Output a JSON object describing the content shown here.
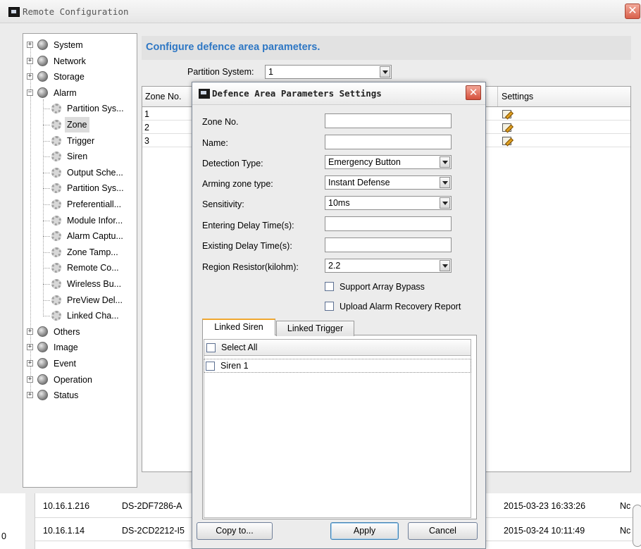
{
  "main_window": {
    "title": "Remote Configuration",
    "close_glyph": "✕"
  },
  "tree": {
    "items": [
      {
        "label": "System",
        "expander": "+",
        "level": 0
      },
      {
        "label": "Network",
        "expander": "+",
        "level": 0
      },
      {
        "label": "Storage",
        "expander": "+",
        "level": 0
      },
      {
        "label": "Alarm",
        "expander": "−",
        "level": 0
      },
      {
        "label": "Partition Sys...",
        "level": 1
      },
      {
        "label": "Zone",
        "level": 1,
        "selected": true
      },
      {
        "label": "Trigger",
        "level": 1
      },
      {
        "label": "Siren",
        "level": 1
      },
      {
        "label": "Output Sche...",
        "level": 1
      },
      {
        "label": "Partition Sys...",
        "level": 1
      },
      {
        "label": "Preferentiall...",
        "level": 1
      },
      {
        "label": "Module Infor...",
        "level": 1
      },
      {
        "label": "Alarm Captu...",
        "level": 1
      },
      {
        "label": "Zone Tamp...",
        "level": 1
      },
      {
        "label": "Remote Co...",
        "level": 1
      },
      {
        "label": "Wireless Bu...",
        "level": 1
      },
      {
        "label": "PreView Del...",
        "level": 1
      },
      {
        "label": "Linked Cha...",
        "level": 1
      },
      {
        "label": "Others",
        "expander": "+",
        "level": 0
      },
      {
        "label": "Image",
        "expander": "+",
        "level": 0
      },
      {
        "label": "Event",
        "expander": "+",
        "level": 0
      },
      {
        "label": "Operation",
        "expander": "+",
        "level": 0
      },
      {
        "label": "Status",
        "expander": "+",
        "level": 0
      }
    ]
  },
  "config": {
    "heading": "Configure defence area parameters.",
    "partition_label": "Partition System:",
    "partition_value": "1",
    "table": {
      "col_zone": "Zone No.",
      "col_settings": "Settings",
      "rows": [
        {
          "zone": "1"
        },
        {
          "zone": "2"
        },
        {
          "zone": "3"
        }
      ]
    }
  },
  "devices": {
    "rows": [
      {
        "ip": "10.16.1.216",
        "model": "DS-2DF7286-A",
        "time": "2015-03-23 16:33:26",
        "status": "Nc"
      },
      {
        "ip": "10.16.1.14",
        "model": "DS-2CD2212-I5",
        "time": "2015-03-24 10:11:49",
        "status": "Nc"
      }
    ],
    "left_fragment": "0"
  },
  "dialog": {
    "title": "Defence Area Parameters Settings",
    "close_glyph": "✕",
    "fields": {
      "zone_no_label": "Zone No.",
      "zone_no_value": "",
      "name_label": "Name:",
      "name_value": "",
      "detection_type_label": "Detection Type:",
      "detection_type_value": "Emergency Button",
      "arming_zone_type_label": "Arming zone type:",
      "arming_zone_type_value": "Instant Defense",
      "sensitivity_label": "Sensitivity:",
      "sensitivity_value": "10ms",
      "entering_delay_label": "Entering Delay Time(s):",
      "entering_delay_value": "",
      "existing_delay_label": "Existing Delay Time(s):",
      "existing_delay_value": "",
      "region_resistor_label": "Region Resistor(kilohm):",
      "region_resistor_value": "2.2"
    },
    "checkboxes": {
      "support_array_bypass": "Support Array Bypass",
      "upload_alarm_recovery": "Upload Alarm Recovery Report"
    },
    "tabs": {
      "linked_siren": "Linked Siren",
      "linked_trigger": "Linked Trigger"
    },
    "siren_list": {
      "select_all": "Select All",
      "items": [
        "Siren 1"
      ]
    },
    "buttons": {
      "copy_to": "Copy to...",
      "apply": "Apply",
      "cancel": "Cancel"
    }
  }
}
